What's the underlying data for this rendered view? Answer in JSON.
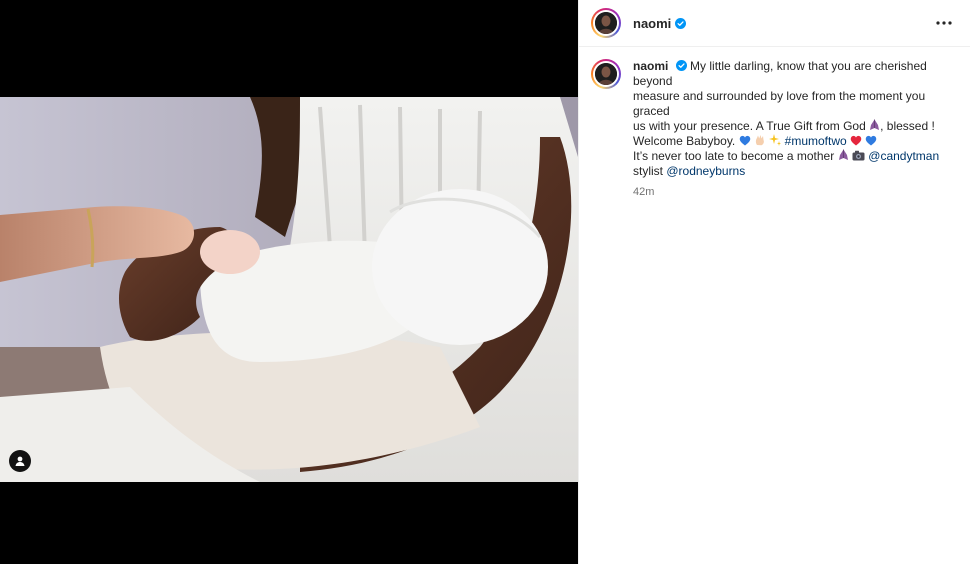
{
  "post": {
    "username": "naomi",
    "caption": {
      "line1": "My little darling, know that you are cherished beyond",
      "line2": "measure and surrounded by love from the moment you graced",
      "line3a": "us with your presence. A True Gift from God",
      "line3b": ", blessed !",
      "line4": "Welcome Babyboy.",
      "hashtag": "#mumoftwo",
      "line5": "It’s never too late to become a mother",
      "mention1": "@candytman",
      "line6": "stylist",
      "mention2": "@rodneyburns"
    },
    "timestamp": "42m"
  },
  "icons": {
    "verified": "verified-badge-icon",
    "more": "more-options-icon",
    "tag": "user-tag-icon"
  },
  "colors": {
    "verified_blue": "#0095f6",
    "link_blue": "#00376b",
    "muted_text": "#737373"
  }
}
